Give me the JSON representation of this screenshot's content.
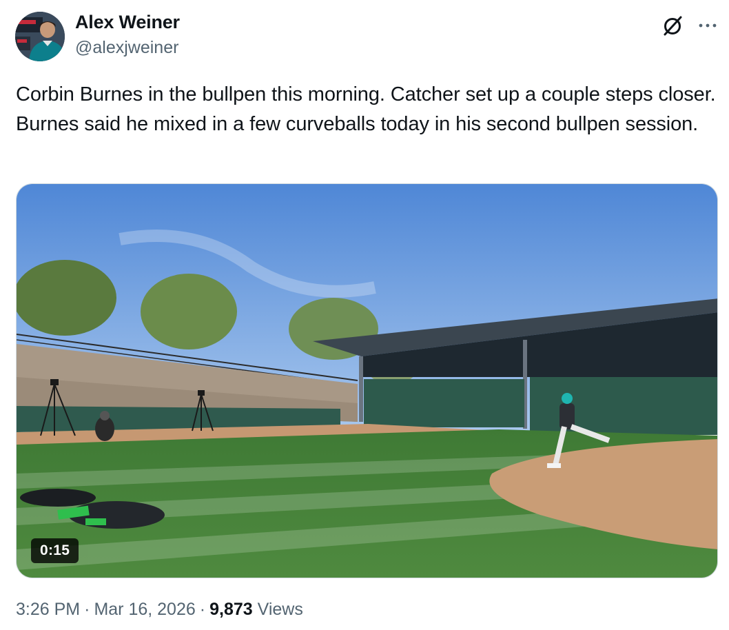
{
  "author": {
    "name": "Alex Weiner",
    "handle": "@alexjweiner"
  },
  "tweet": {
    "text": "Corbin Burnes in the bullpen this morning. Catcher set up a couple steps closer. Burnes said he mixed in a few curveballs today in his second bullpen session."
  },
  "media": {
    "type": "video",
    "duration": "0:15"
  },
  "meta": {
    "time": "3:26 PM",
    "separator": "·",
    "date": "Mar 16, 2026",
    "views_count": "9,873",
    "views_label": "Views"
  },
  "icons": {
    "grok": "grok-slash-icon",
    "more": "more-horizontal-icon"
  },
  "colors": {
    "text_primary": "#0f1419",
    "text_secondary": "#536471",
    "border": "#cfd9de"
  }
}
